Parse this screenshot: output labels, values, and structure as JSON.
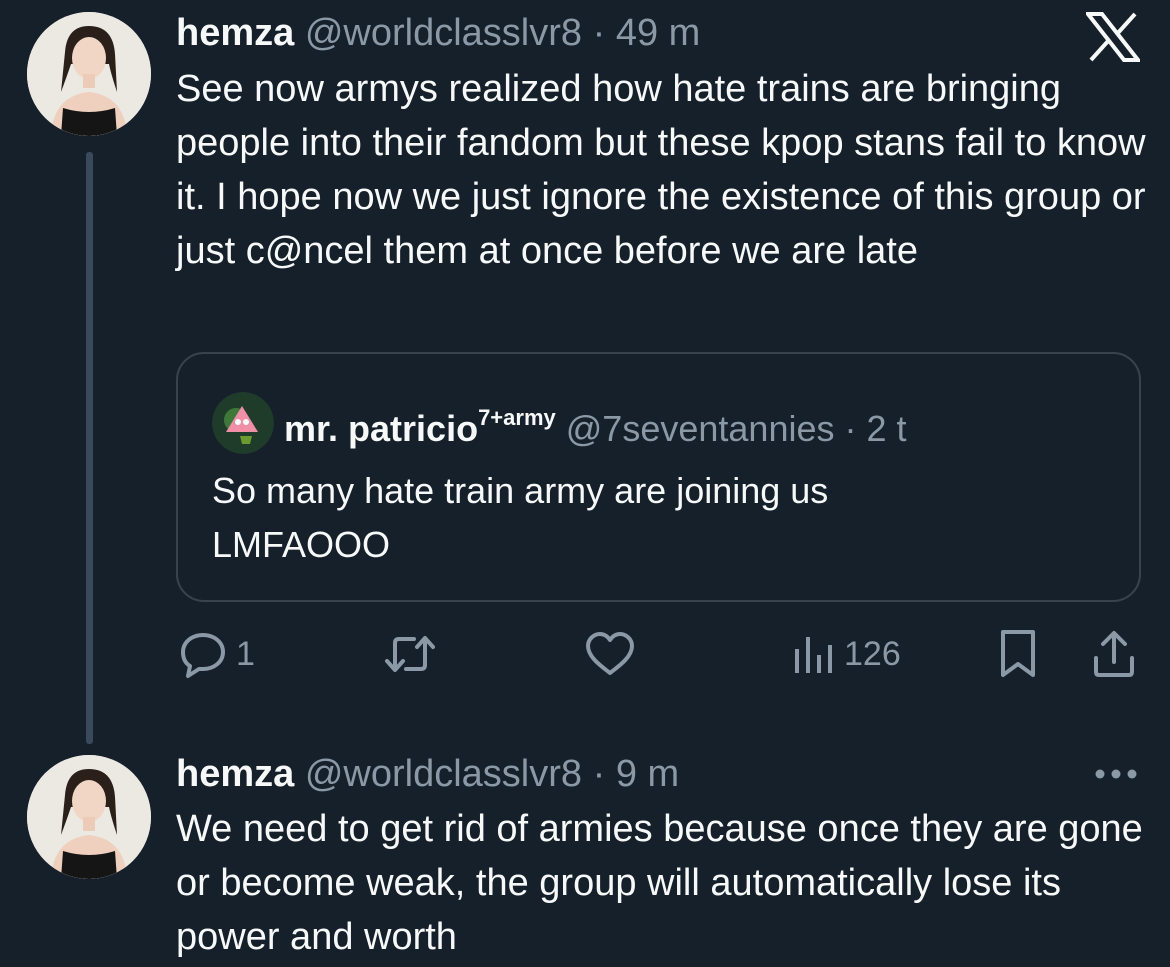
{
  "thread_line_color": "#3a4a5a",
  "tweet1": {
    "author_name": "hemza",
    "handle": "@worldclasslvr8",
    "separator": "·",
    "time": "49 m",
    "text": "See now armys realized how hate trains are bringing people into their fandom but these kpop stans fail to know it. I hope now we just ignore the existence of this group or just c@ncel them at once before we are late",
    "quote": {
      "author_name": "mr. patricio",
      "author_sup": "7+army",
      "handle": "@7seventannies",
      "separator": "·",
      "time": "2 t",
      "text_line1": "So many hate train army are joining us",
      "text_line2": "LMFAOOO"
    },
    "actions": {
      "reply_count": "1",
      "views_count": "126"
    }
  },
  "tweet2": {
    "author_name": "hemza",
    "handle": "@worldclasslvr8",
    "separator": "·",
    "time": "9 m",
    "text": "We need to get rid of armies because once they are gone or become weak, the group will automatically lose its power and worth"
  },
  "icons": {
    "logo": "x-logo-icon",
    "reply": "reply-icon",
    "retweet": "retweet-icon",
    "like": "heart-icon",
    "views": "views-icon",
    "bookmark": "bookmark-icon",
    "share": "share-icon",
    "more": "more-icon"
  }
}
